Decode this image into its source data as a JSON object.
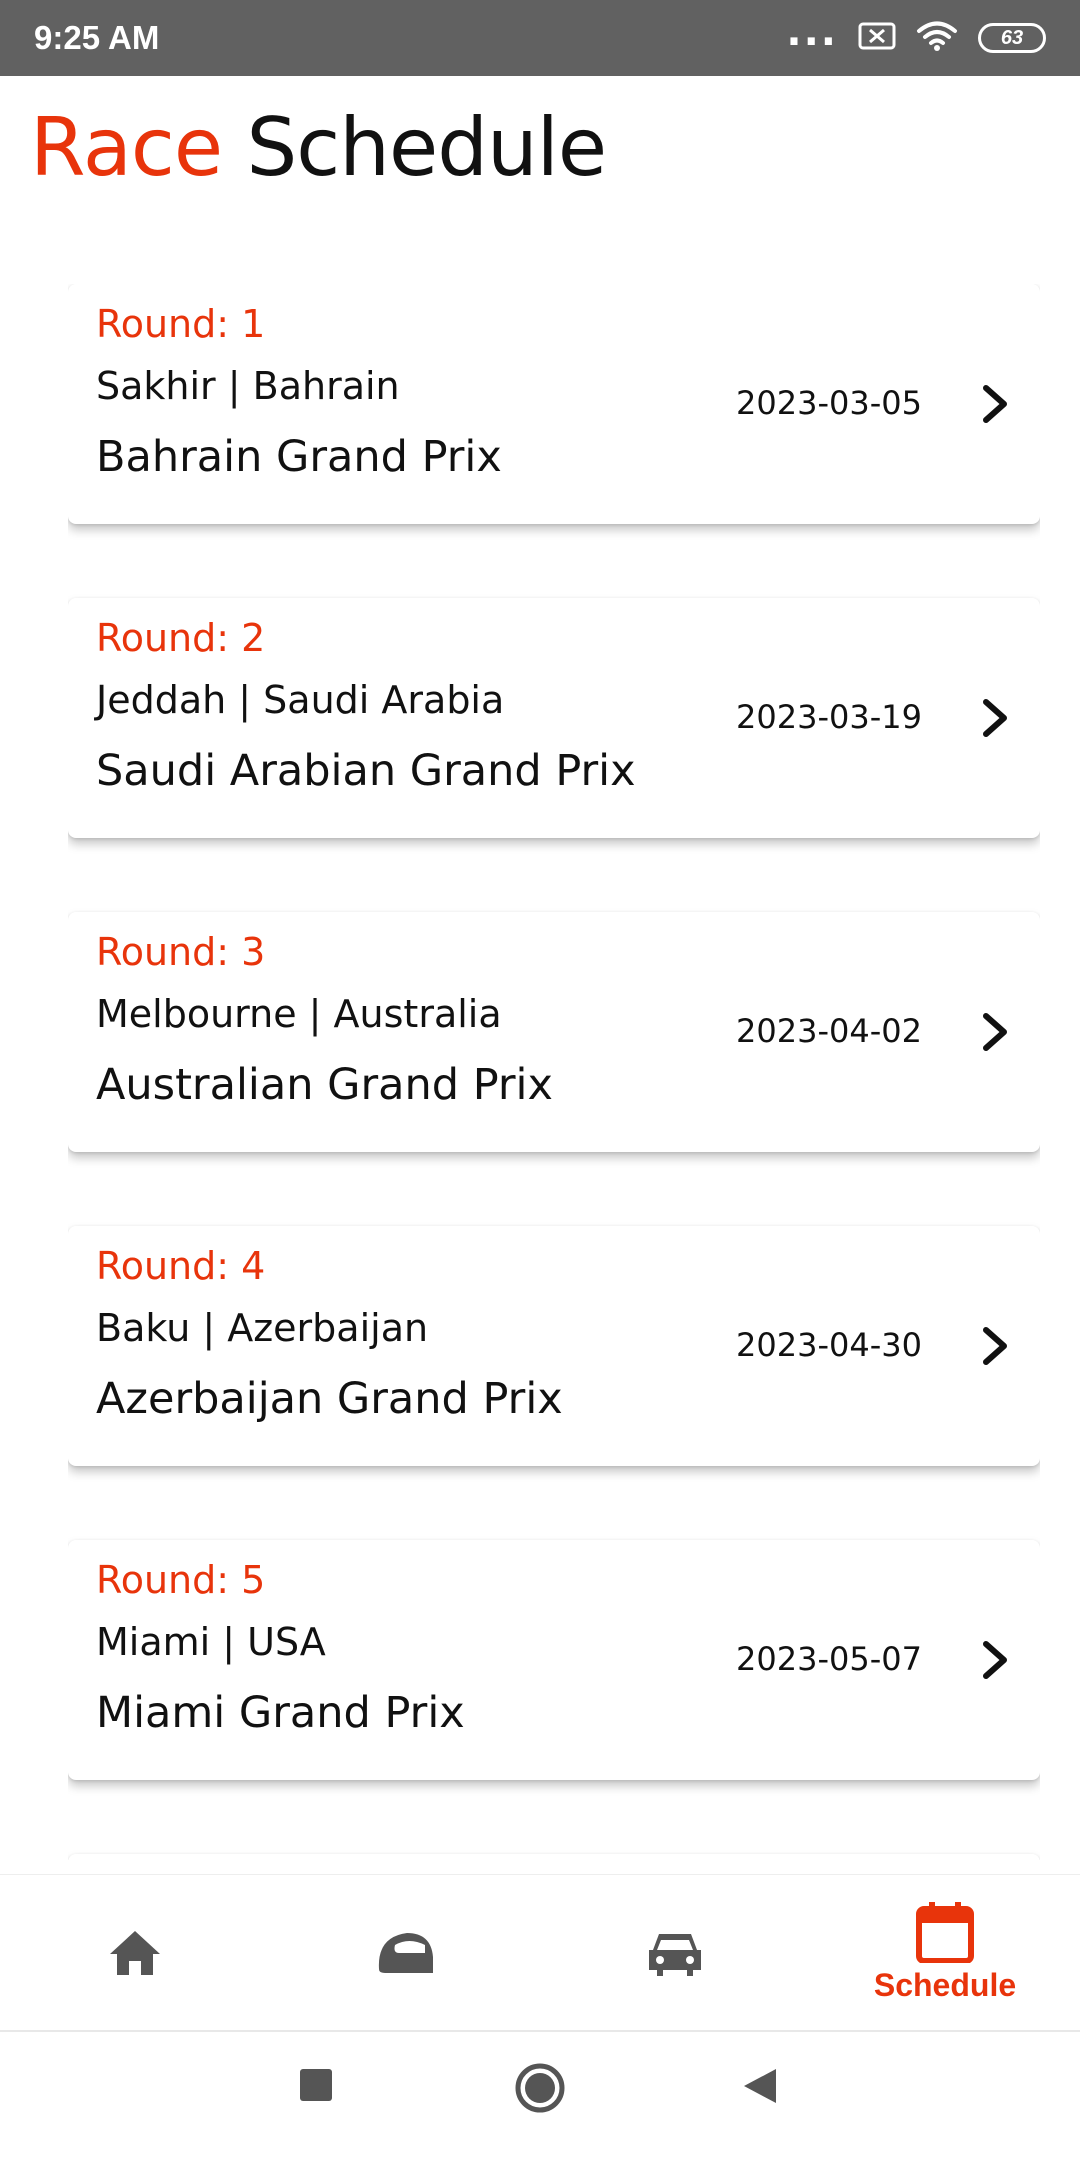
{
  "status_bar": {
    "time": "9:25 AM",
    "dots": "...",
    "battery": "63"
  },
  "header": {
    "title_accent": "Race",
    "title_rest": "Schedule"
  },
  "races": [
    {
      "round": "Round: 1",
      "location": "Sakhir | Bahrain",
      "name": "Bahrain Grand Prix",
      "date": "2023-03-05"
    },
    {
      "round": "Round: 2",
      "location": "Jeddah | Saudi Arabia",
      "name": "Saudi Arabian Grand Prix",
      "date": "2023-03-19"
    },
    {
      "round": "Round: 3",
      "location": "Melbourne | Australia",
      "name": "Australian Grand Prix",
      "date": "2023-04-02"
    },
    {
      "round": "Round: 4",
      "location": "Baku | Azerbaijan",
      "name": "Azerbaijan Grand Prix",
      "date": "2023-04-30"
    },
    {
      "round": "Round: 5",
      "location": "Miami | USA",
      "name": "Miami Grand Prix",
      "date": "2023-05-07"
    }
  ],
  "bottom_nav": {
    "active_label": "Schedule",
    "items": [
      "home-icon",
      "helmet-icon",
      "car-icon",
      "calendar-icon"
    ]
  },
  "colors": {
    "accent": "#e8340b",
    "status_bar": "#616161",
    "inactive_icon": "#555555"
  }
}
